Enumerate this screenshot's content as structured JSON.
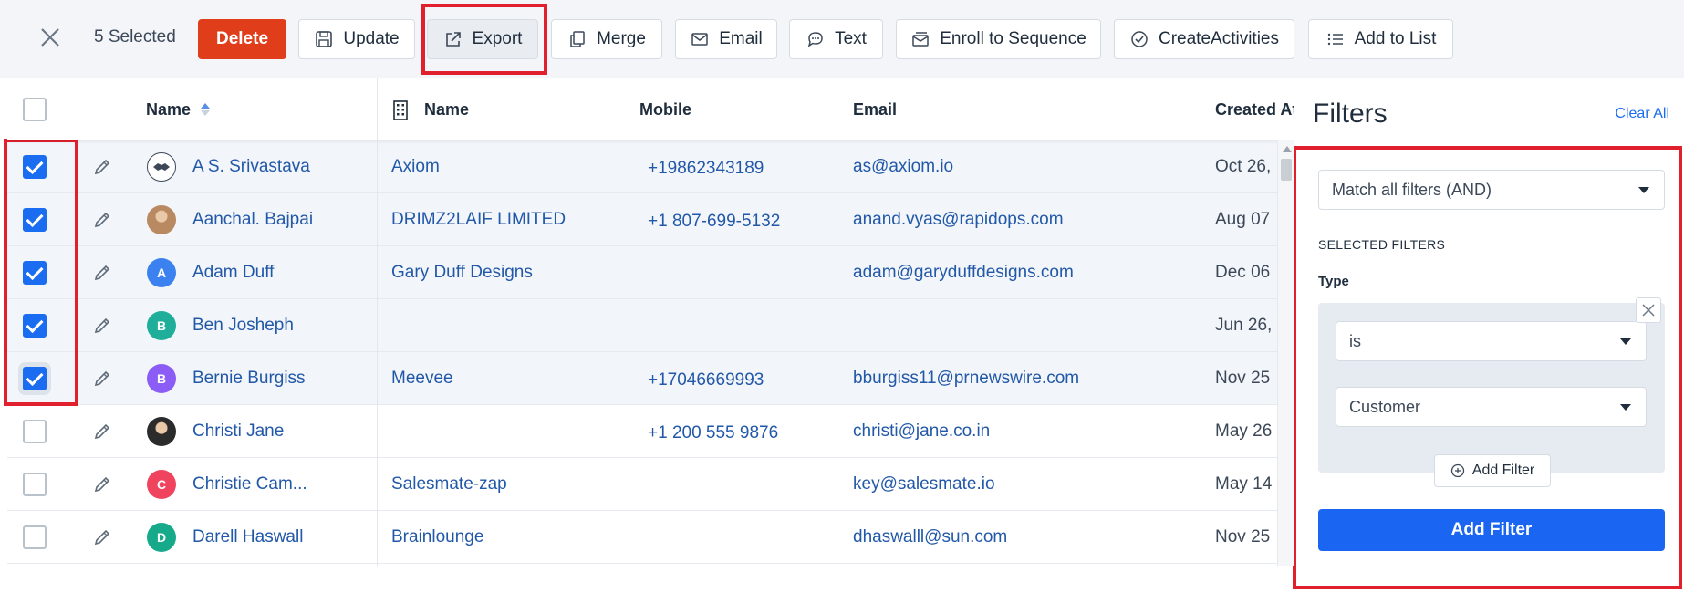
{
  "toolbar": {
    "selected_count": "5 Selected",
    "delete_label": "Delete",
    "update_label": "Update",
    "export_label": "Export",
    "merge_label": "Merge",
    "email_label": "Email",
    "text_label": "Text",
    "enroll_label": "Enroll to Sequence",
    "create_activities_label": "CreateActivities",
    "add_to_list_label": "Add to List"
  },
  "table": {
    "columns": {
      "name": "Name",
      "company_name": "Name",
      "mobile": "Mobile",
      "email": "Email",
      "created_at": "Created At"
    },
    "rows": [
      {
        "name": "A S. Srivastava",
        "company": "Axiom",
        "mobile": "+19862343189",
        "email": "as@axiom.io",
        "created": "Oct 26,",
        "checked": true,
        "avatar": {
          "kind": "icon",
          "icon": "handshake-icon"
        }
      },
      {
        "name": "Aanchal. Bajpai",
        "company": "DRIMZ2LAIF LIMITED",
        "mobile": "+1 807-699-5132",
        "email": "anand.vyas@rapidops.com",
        "created": "Aug 07",
        "checked": true,
        "avatar": {
          "kind": "photo",
          "color": "#b98a62"
        }
      },
      {
        "name": "Adam Duff",
        "company": "Gary Duff Designs",
        "mobile": "",
        "email": "adam@garyduffdesigns.com",
        "created": "Dec 06",
        "checked": true,
        "avatar": {
          "kind": "letter",
          "letter": "A",
          "color": "#3b82f0"
        }
      },
      {
        "name": "Ben Josheph",
        "company": "",
        "mobile": "",
        "email": "",
        "created": "Jun 26,",
        "checked": true,
        "avatar": {
          "kind": "letter",
          "letter": "B",
          "color": "#1fae9a"
        }
      },
      {
        "name": "Bernie Burgiss",
        "company": "Meevee",
        "mobile": "+17046669993",
        "email": "bburgiss11@prnewswire.com",
        "created": "Nov 25",
        "checked": true,
        "avatar": {
          "kind": "letter",
          "letter": "B",
          "color": "#8b5cf6"
        }
      },
      {
        "name": "Christi Jane",
        "company": "",
        "mobile": "+1 200 555 9876",
        "email": "christi@jane.co.in",
        "created": "May 26",
        "checked": false,
        "avatar": {
          "kind": "photo",
          "color": "#2b2b2b"
        }
      },
      {
        "name": "Christie Cam...",
        "company": "Salesmate-zap",
        "mobile": "",
        "email": "key@salesmate.io",
        "created": "May 14",
        "checked": false,
        "avatar": {
          "kind": "letter",
          "letter": "C",
          "color": "#f0435e"
        }
      },
      {
        "name": "Darell Haswall",
        "company": "Brainlounge",
        "mobile": "",
        "email": "dhaswalll@sun.com",
        "created": "Nov 25",
        "checked": false,
        "avatar": {
          "kind": "letter",
          "letter": "D",
          "color": "#16a98a"
        }
      }
    ]
  },
  "filters": {
    "title": "Filters",
    "clear_all": "Clear All",
    "match_mode": "Match all filters (AND)",
    "selected_filters_label": "SELECTED FILTERS",
    "type_label": "Type",
    "operator_value": "is",
    "type_value": "Customer",
    "add_filter_small": "Add Filter",
    "add_filter_button": "Add Filter"
  },
  "colors": {
    "accent": "#1a66f2",
    "danger": "#e03d1a",
    "link": "#2258a8",
    "highlight_frame": "#e0202c"
  }
}
